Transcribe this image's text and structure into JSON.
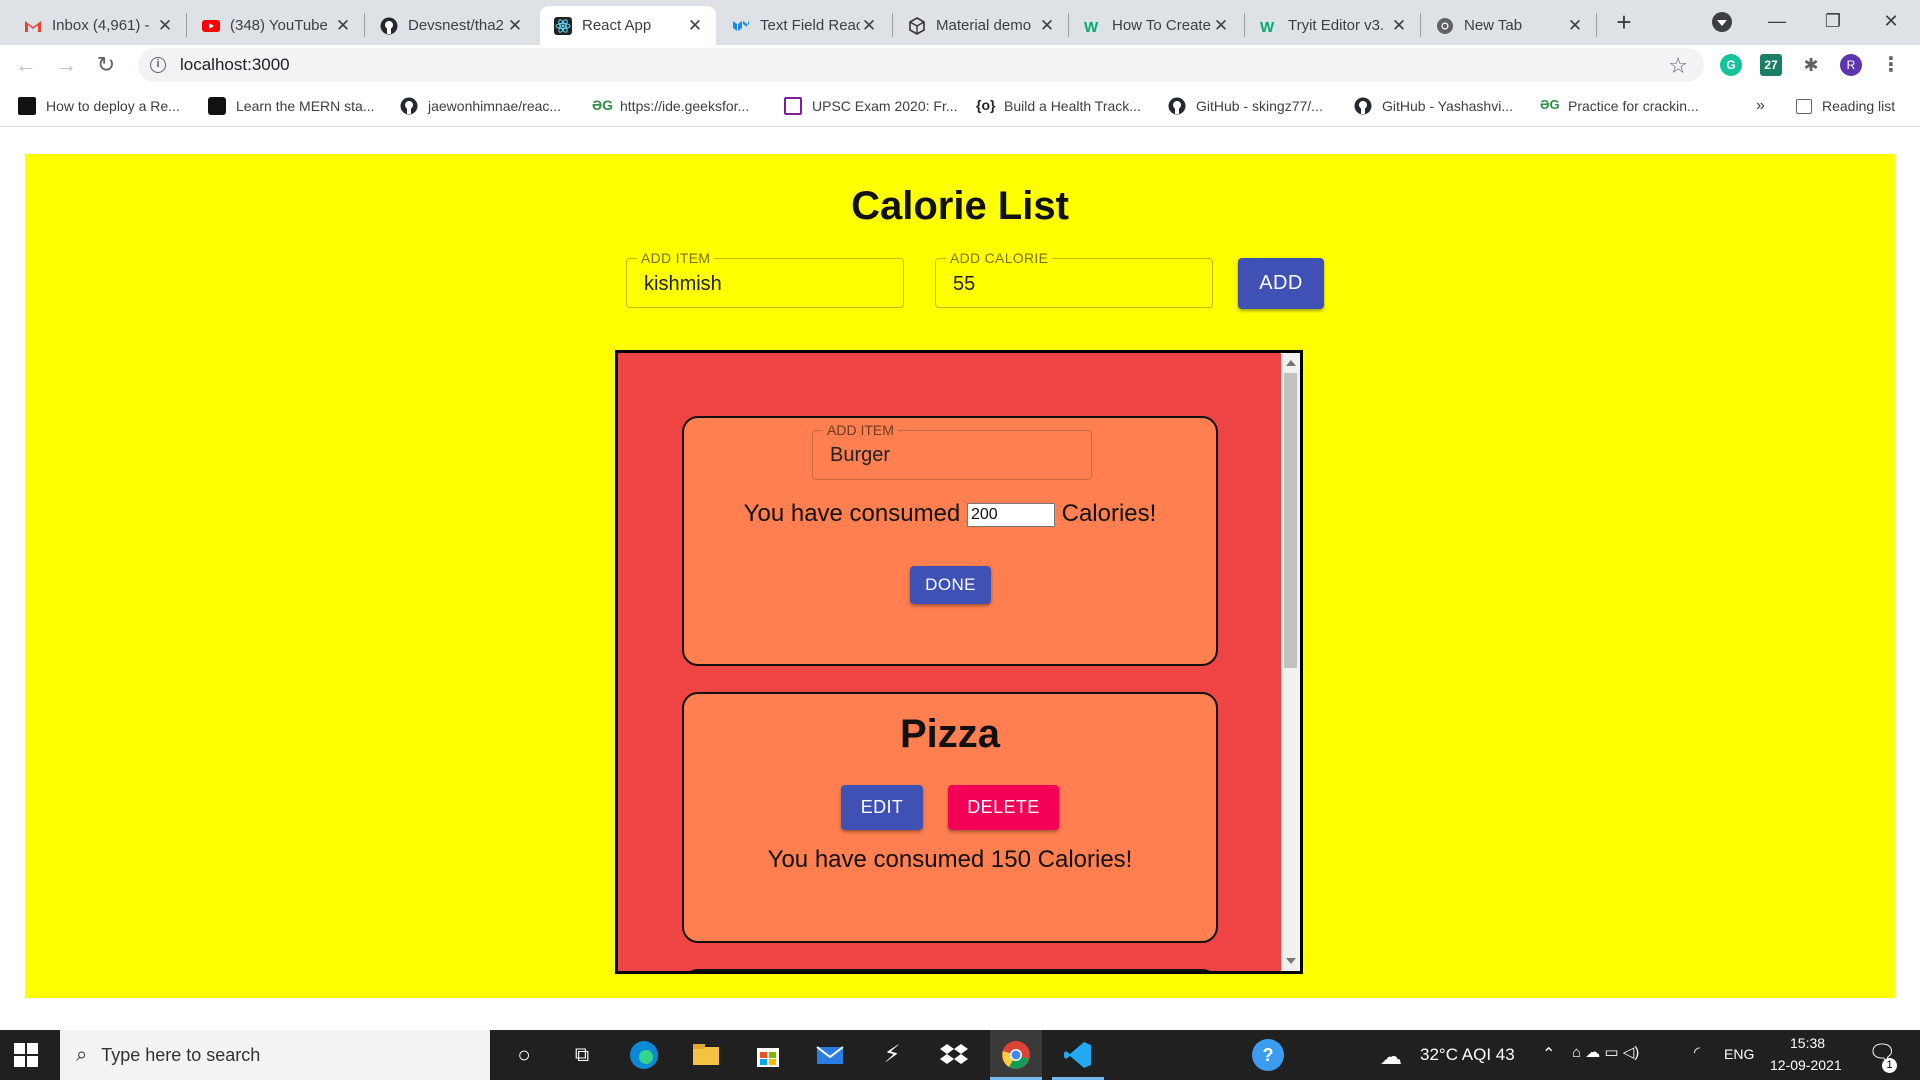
{
  "browser": {
    "tabs": [
      {
        "title": "Inbox (4,961) -",
        "icon": "gmail-icon",
        "color": "#ea4335"
      },
      {
        "title": "(348) YouTube",
        "icon": "youtube-icon",
        "color": "#ff0000"
      },
      {
        "title": "Devsnest/tha2",
        "icon": "github-icon",
        "color": "#24292e"
      },
      {
        "title": "React App",
        "icon": "react-icon",
        "color": "#222222"
      },
      {
        "title": "Text Field Reac",
        "icon": "mui-icon",
        "color": "#1e88e5"
      },
      {
        "title": "Material demo",
        "icon": "codesandbox-icon",
        "color": "#333333"
      },
      {
        "title": "How To Create",
        "icon": "w3schools-icon",
        "color": "#04aa6d"
      },
      {
        "title": "Tryit Editor v3.",
        "icon": "w3schools-icon",
        "color": "#04aa6d"
      },
      {
        "title": "New Tab",
        "icon": "chrome-icon",
        "color": "#5f6368"
      }
    ],
    "active_tab": 3,
    "address": "localhost:3000",
    "extension_badge": "27",
    "profile_initial": "R",
    "bookmarks": [
      {
        "title": "How to deploy a Re...",
        "icon": "logo-icon"
      },
      {
        "title": "Learn the MERN sta...",
        "icon": "video-icon"
      },
      {
        "title": "jaewonhimnae/reac...",
        "icon": "github-icon"
      },
      {
        "title": "https://ide.geeksfor...",
        "icon": "gfg-icon"
      },
      {
        "title": "UPSC Exam 2020: Fr...",
        "icon": "book-icon"
      },
      {
        "title": "Build a Health Track...",
        "icon": "braces-icon"
      },
      {
        "title": "GitHub - skingz77/...",
        "icon": "github-icon"
      },
      {
        "title": "GitHub - Yashashvi...",
        "icon": "github-icon"
      },
      {
        "title": "Practice for crackin...",
        "icon": "gfg-icon"
      }
    ],
    "bookmarks_overflow": "»",
    "reading_list": "Reading list"
  },
  "app": {
    "title": "Calorie List",
    "add_item_label": "ADD ITEM",
    "add_item_value": "kishmish",
    "add_calorie_label": "ADD CALORIE",
    "add_calorie_value": "55",
    "add_button": "ADD",
    "cards": [
      {
        "mode": "edit",
        "field_label": "ADD ITEM",
        "field_value": "Burger",
        "consumed_prefix": "You have consumed",
        "calorie_value": "200",
        "consumed_suffix": "Calories!",
        "done_button": "DONE"
      },
      {
        "mode": "view",
        "name": "Pizza",
        "edit_button": "EDIT",
        "delete_button": "DELETE",
        "consumed_text": "You have consumed 150 Calories!"
      }
    ]
  },
  "taskbar": {
    "search_placeholder": "Type here to search",
    "weather": "32°C  AQI 43",
    "language": "ENG",
    "time": "15:38",
    "date": "12-09-2021",
    "notification_count": "1"
  },
  "colors": {
    "page_bg": "#ffff00",
    "list_bg": "#ef4444",
    "card_bg": "#ff7f50",
    "primary": "#3f51b5",
    "danger": "#f50057"
  }
}
